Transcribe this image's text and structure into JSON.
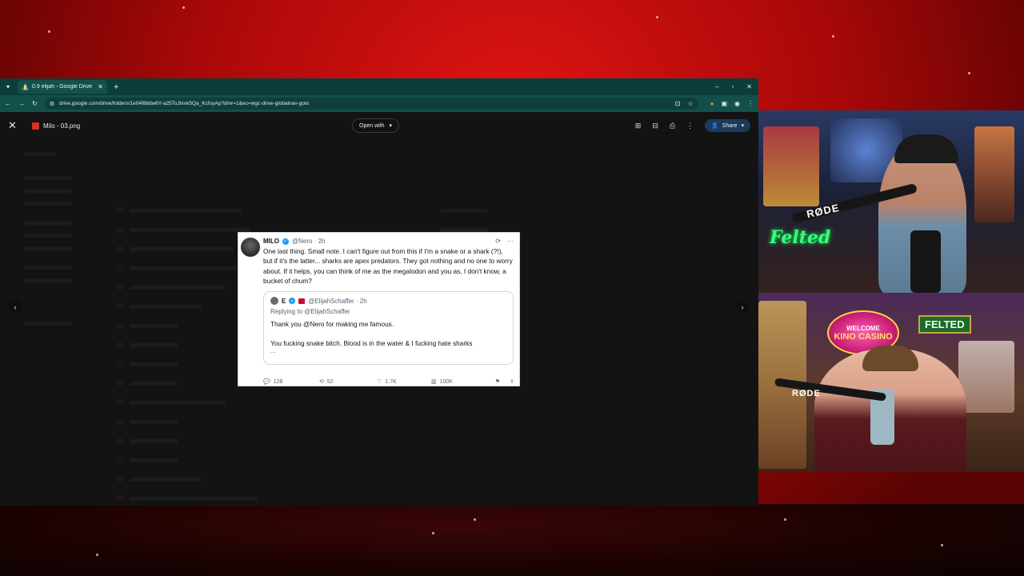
{
  "browser": {
    "tab_title": "0.9 elijah - Google Drive",
    "tab_close": "✕",
    "new_tab": "+",
    "window_controls": [
      "–",
      "▫",
      "✕"
    ],
    "url": "drive.google.com/drive/folders/1e04f88dw6Y-a25ToJtxvk5Qa_KcfoyAp?dmr=1&ec=wgc-drive-globalnav-goto"
  },
  "viewer": {
    "close": "✕",
    "file_name": "Milo - 03.png",
    "open_with_label": "Open with",
    "share_label": "Share",
    "prev_arrow": "‹",
    "next_arrow": "›"
  },
  "tweet": {
    "name": "MILO",
    "handle": "@Nero · 2h",
    "body": "One last thing. Small note. I can't figure out from this if I'm a snake or a shark (?!), but if it's the latter... sharks are apex predators. They got nothing and no one to worry about. If it helps, you can think of me as the megalodon and you as, I don't know, a bucket of chum?",
    "quote": {
      "name": "E",
      "handle": "@ElijahSchaffer · 2h",
      "replying": "Replying to @ElijahSchaffer",
      "text1": "Thank you @Nero for making me famous.",
      "text2": "You fucking snake bitch. Blood is in the water & I fucking hate sharks",
      "ellipsis": "..."
    },
    "stats": {
      "replies": "128",
      "reposts": "52",
      "likes": "1.7K",
      "views": "100K"
    }
  },
  "webcam": {
    "cam1_mic_brand": "RØDE",
    "cam1_neon": "Felted",
    "cam2_mic_brand": "RØDE",
    "cam2_sign_top": "WELCOME",
    "cam2_sign_main": "KINO CASINO",
    "cam2_felted": "FELTED"
  },
  "colors": {
    "backdrop_red": "#c40d0d",
    "browser_tab": "#0b3d3a",
    "share_blue": "#1b3a5c",
    "verified_blue": "#1d9bf0"
  }
}
